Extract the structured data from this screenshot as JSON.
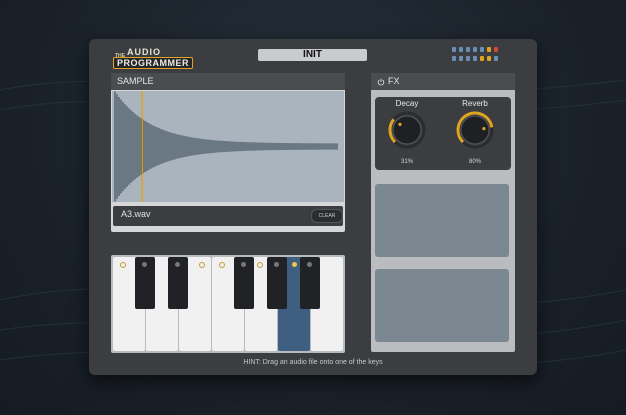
{
  "header": {
    "logo_small": "THE",
    "logo_top": "AUDIO",
    "logo_bottom": "PROGRAMMER",
    "preset_name": "INIT"
  },
  "sample": {
    "section_title": "SAMPLE",
    "filename": "A3.wav",
    "clear_label": "CLEAR",
    "playhead_position": 0.13
  },
  "fx": {
    "section_title": "FX",
    "knobs": [
      {
        "label": "Decay",
        "value": "31%",
        "fraction": 0.31
      },
      {
        "label": "Reverb",
        "value": "80%",
        "fraction": 0.8
      }
    ]
  },
  "keyboard": {
    "active_white_key": 5,
    "white_keys": 7
  },
  "hint": "HINT: Drag an audio file onto one of the keys",
  "colors": {
    "accent": "#e0a420",
    "active_key": "#3f5f80",
    "panel": "#3b3d40",
    "waveform": "#2b3b4a"
  }
}
